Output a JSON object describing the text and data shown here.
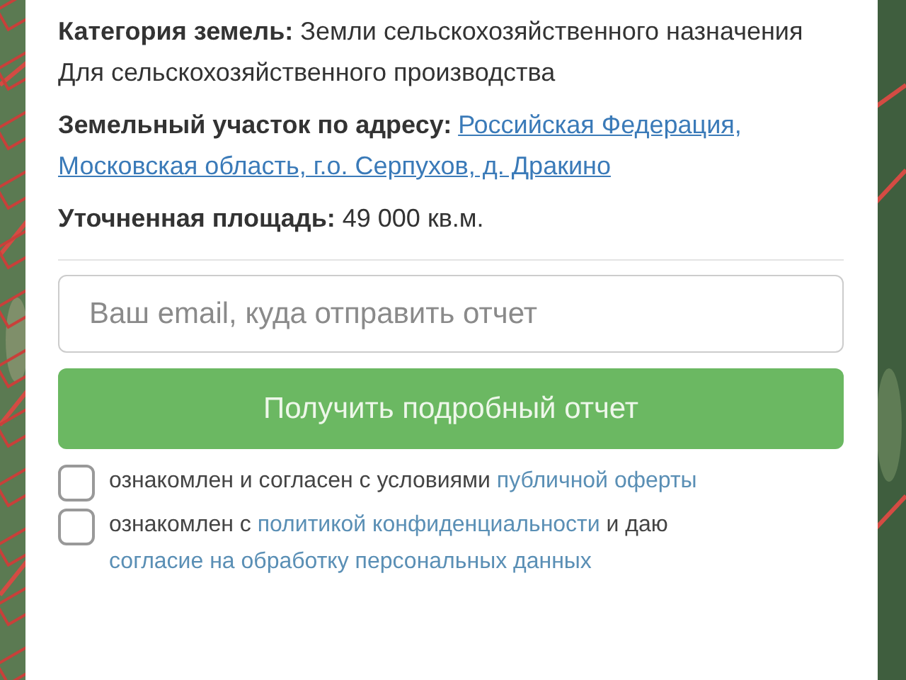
{
  "details": [
    {
      "text": "**Категория земель:** Земли сельскохозяйственного назначения"
    },
    {
      "text": "Для сельскохозяйственного производства"
    }
  ],
  "address": {
    "label": "Земельный участок по адресу:",
    "link_lines": [
      "Российская Федерация,",
      "Московская область, г.о. Серпухов, д. Дракино"
    ]
  },
  "area": {
    "text": "**Уточненная площадь:** 49 000 кв.м."
  },
  "email_field": {
    "placeholder": "Ваш email, куда отправить отчет"
  },
  "submit_button": {
    "label": "Получить подробный отчет"
  },
  "agreements": [
    {
      "checked": false,
      "parts": [
        {
          "kind": "text",
          "text": "ознакомлен и согласен с условиями"
        },
        {
          "kind": "link",
          "text": "публичной оферты"
        }
      ]
    },
    {
      "checked": false,
      "parts": [
        {
          "kind": "text",
          "text": "ознакомлен с"
        },
        {
          "kind": "link",
          "text": "политикой конфиденциальности"
        },
        {
          "kind": "text",
          "text": "и даю"
        },
        {
          "kind": "link",
          "text": "согласие на обработку персональных данных"
        }
      ]
    }
  ]
}
